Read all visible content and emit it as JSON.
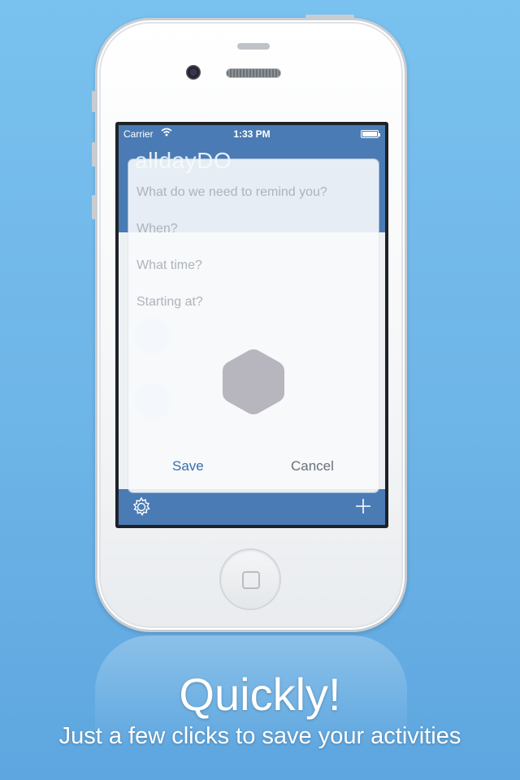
{
  "device": {
    "status_bar": {
      "carrier": "Carrier",
      "time": "1:33 PM",
      "wifi_icon": "wifi-icon",
      "battery_icon": "battery-full-icon"
    }
  },
  "app": {
    "title": "alldayDO"
  },
  "dialog": {
    "fields": [
      {
        "placeholder": "What do we need to remind you?"
      },
      {
        "placeholder": "When?"
      },
      {
        "placeholder": "What time?"
      },
      {
        "placeholder": "Starting at?"
      }
    ],
    "spinner_icon": "hexagon-spinner-icon",
    "save_label": "Save",
    "cancel_label": "Cancel"
  },
  "toolbar": {
    "settings_icon": "gear-icon",
    "add_icon": "plus-icon"
  },
  "promo": {
    "headline": "Quickly!",
    "subline": "Just a few clicks to save your activities"
  },
  "colors": {
    "background": "#72b9ea",
    "app_bar": "#4a7bb4",
    "save_text": "#3a6ea6",
    "spinner": "#b7b6bf"
  }
}
